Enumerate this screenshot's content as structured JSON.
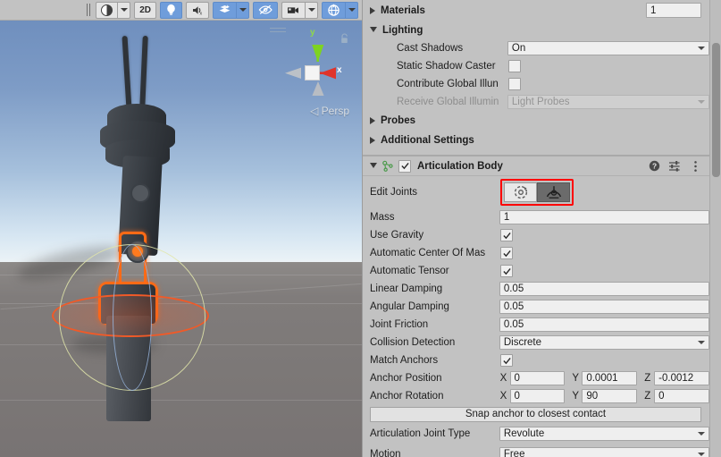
{
  "scene_toolbar": {
    "drag_handle": "drag-handle",
    "shading_mode": {
      "icon": "shaded-sphere-icon",
      "label": ""
    },
    "mode_2d": "2D",
    "lighting_toggle": {
      "icon": "lightbulb-icon",
      "active": true
    },
    "audio_toggle": {
      "icon": "audio-muted-icon",
      "active": false
    },
    "effects_toggle": {
      "icon": "fx-layers-icon",
      "active": true
    },
    "visibility_toggle": {
      "icon": "eye-crossed-icon",
      "active": true
    },
    "camera_toggle": {
      "icon": "camera-icon",
      "active": false
    },
    "gizmos_toggle": {
      "icon": "gizmos-globe-icon",
      "active": true
    }
  },
  "scene_gizmo": {
    "axis_x": "x",
    "axis_y": "y",
    "projection": "Persp",
    "projection_prefix": "◁",
    "lock": "lock-icon"
  },
  "inspector": {
    "materials": {
      "label": "Materials",
      "count": "1",
      "expanded": false
    },
    "lighting": {
      "label": "Lighting",
      "expanded": true,
      "cast_shadows": {
        "label": "Cast Shadows",
        "value": "On"
      },
      "static_shadow_caster": {
        "label": "Static Shadow Caster",
        "checked": false
      },
      "contribute_gi": {
        "label": "Contribute Global Illun",
        "checked": false
      },
      "receive_gi": {
        "label": "Receive Global Illumin",
        "value": "Light Probes",
        "disabled": true
      }
    },
    "probes": {
      "label": "Probes",
      "expanded": false
    },
    "additional_settings": {
      "label": "Additional Settings",
      "expanded": false
    },
    "articulation_body": {
      "title": "Articulation Body",
      "enabled": true,
      "expanded": true,
      "icon": "articulation-body-icon",
      "help_icon": "help-icon",
      "preset_icon": "preset-icon",
      "menu_icon": "kebab-menu-icon",
      "edit_joints": {
        "label": "Edit Joints",
        "button_1_icon": "edit-joint-rotation-icon",
        "button_2_icon": "edit-joint-anchor-icon",
        "selected_index": 1,
        "highlight_color": "#ff0000"
      },
      "mass": {
        "label": "Mass",
        "value": "1"
      },
      "use_gravity": {
        "label": "Use Gravity",
        "checked": true
      },
      "automatic_center_of_mass": {
        "label": "Automatic Center Of Mas",
        "checked": true
      },
      "automatic_tensor": {
        "label": "Automatic Tensor",
        "checked": true
      },
      "linear_damping": {
        "label": "Linear Damping",
        "value": "0.05"
      },
      "angular_damping": {
        "label": "Angular Damping",
        "value": "0.05"
      },
      "joint_friction": {
        "label": "Joint Friction",
        "value": "0.05"
      },
      "collision_detection": {
        "label": "Collision Detection",
        "value": "Discrete"
      },
      "match_anchors": {
        "label": "Match Anchors",
        "checked": true
      },
      "anchor_position": {
        "label": "Anchor Position",
        "x_label": "X",
        "x": "0",
        "y_label": "Y",
        "y": "0.0001",
        "z_label": "Z",
        "z": "-0.0012"
      },
      "anchor_rotation": {
        "label": "Anchor Rotation",
        "x_label": "X",
        "x": "0",
        "y_label": "Y",
        "y": "90",
        "z_label": "Z",
        "z": "0"
      },
      "snap_button": "Snap anchor to closest contact",
      "joint_type": {
        "label": "Articulation Joint Type",
        "value": "Revolute"
      },
      "motion": {
        "label": "Motion",
        "value": "Free"
      }
    }
  },
  "colors": {
    "accent_blue": "#6f9ddb",
    "panel_bg": "#c2c2c2",
    "field_bg": "#efefef",
    "selection_orange": "#ff6a16",
    "highlight_red": "#ff0000",
    "axis_green": "#7ed321",
    "axis_red": "#e0342b",
    "component_icon_green": "#4a9a4a"
  }
}
